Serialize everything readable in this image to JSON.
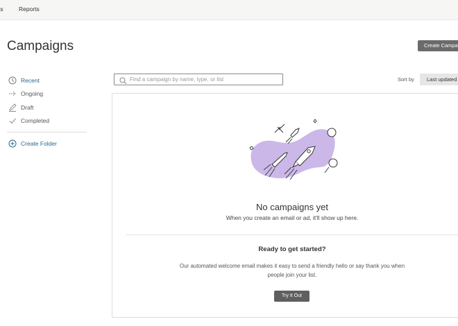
{
  "topnav": {
    "items": [
      "ts",
      "Reports"
    ]
  },
  "header": {
    "title": "Campaigns",
    "create_label": "Create Campaign"
  },
  "sidebar": {
    "items": [
      {
        "label": "Recent",
        "icon": "clock-icon",
        "active": true
      },
      {
        "label": "Ongoing",
        "icon": "arrow-right-icon"
      },
      {
        "label": "Draft",
        "icon": "pencil-icon"
      },
      {
        "label": "Completed",
        "icon": "check-icon"
      }
    ],
    "create_folder_label": "Create Folder"
  },
  "search": {
    "placeholder": "Find a campaign by name, type, or list",
    "value": ""
  },
  "sort": {
    "label": "Sort by",
    "selected": "Last updated"
  },
  "empty": {
    "title": "No campaigns yet",
    "subtitle": "When you create an email or ad, it'll show up here.",
    "cta_title": "Ready to get started?",
    "cta_desc": "Our automated welcome email makes it easy to send a friendly hello or say thank you when people join your list.",
    "cta_button": "Try It Out"
  },
  "colors": {
    "accent": "#266a8a",
    "illustration_blob": "#cbb8e8",
    "button": "#5f5f5f"
  }
}
